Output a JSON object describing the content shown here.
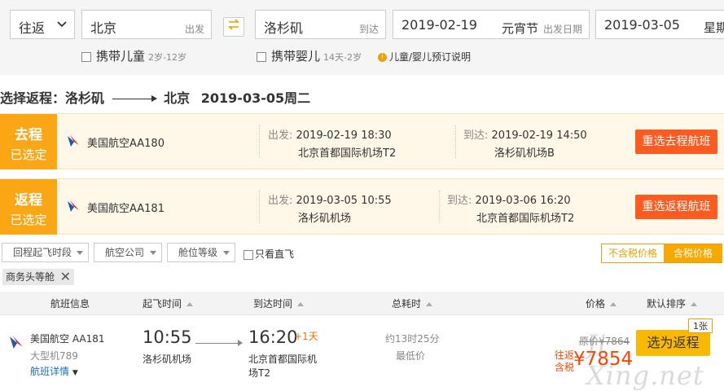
{
  "search": {
    "trip_type": "往返",
    "from_city": "北京",
    "from_hint": "出发",
    "to_city": "洛杉矶",
    "to_hint": "到达",
    "depart_date": "2019-02-19",
    "depart_note": "元宵节",
    "depart_hint": "出发日期",
    "return_date": "2019-03-05",
    "return_weekday_partial": "星期",
    "child_label": "携带儿童",
    "child_age": "2岁-12岁",
    "infant_label": "携带婴儿",
    "infant_age": "14天-2岁",
    "booking_note": "儿童/婴儿预订说明"
  },
  "heading": {
    "prefix": "选择返程：洛杉矶",
    "dest": "北京",
    "date": "2019-03-05周二"
  },
  "selected": [
    {
      "badge_top": "去程",
      "badge_bottom": "已选定",
      "airline": "美国航空AA180",
      "depart_label": "出发:",
      "depart_time": "2019-02-19 18:30",
      "depart_airport": "北京首都国际机场T2",
      "arrive_label": "到达:",
      "arrive_time": "2019-02-19 14:50",
      "arrive_airport": "洛杉矶机场B",
      "button": "重选去程航班"
    },
    {
      "badge_top": "返程",
      "badge_bottom": "已选定",
      "airline": "美国航空AA181",
      "depart_label": "出发:",
      "depart_time": "2019-03-05 10:55",
      "depart_airport": "洛杉矶机场",
      "arrive_label": "到达:",
      "arrive_time": "2019-03-06 16:20",
      "arrive_airport": "北京首都国际机场T2",
      "button": "重选返程航班"
    }
  ],
  "filters": {
    "time_slot": "回程起飞时段",
    "airline": "航空公司",
    "cabin": "舱位等级",
    "direct_only": "只看直飞",
    "price_excl": "不含税价格",
    "price_incl": "含税价格",
    "active_tag": "商务头等舱"
  },
  "table_header": {
    "flight_info": "航班信息",
    "depart_time": "起飞时间",
    "arrive_time": "到达时间",
    "duration": "总耗时",
    "price": "价格",
    "sort_default": "默认排序"
  },
  "flight": {
    "airline": "美国航空",
    "number": "AA181",
    "aircraft": "大型机789",
    "details_link": "航班详情",
    "depart_time": "10:55",
    "depart_airport": "洛杉矶机场",
    "arrive_time": "16:20",
    "plus_day": "+1天",
    "arrive_airport_line1": "北京首都国际机",
    "arrive_airport_line2": "场T2",
    "duration": "约13时25分",
    "duration_note": "最低价",
    "original_price": "原价¥7864",
    "price_prefix_line1": "往返",
    "price_prefix_line2": "含税",
    "price": "¥7854",
    "seats_left": "1张",
    "choose_button": "选为返程"
  },
  "watermark": "Ji Xing.net",
  "colors": {
    "accent_orange": "#fba615",
    "button_red": "#ff5a1f",
    "choose_yellow": "#f9b900",
    "price_red": "#ff4400"
  }
}
